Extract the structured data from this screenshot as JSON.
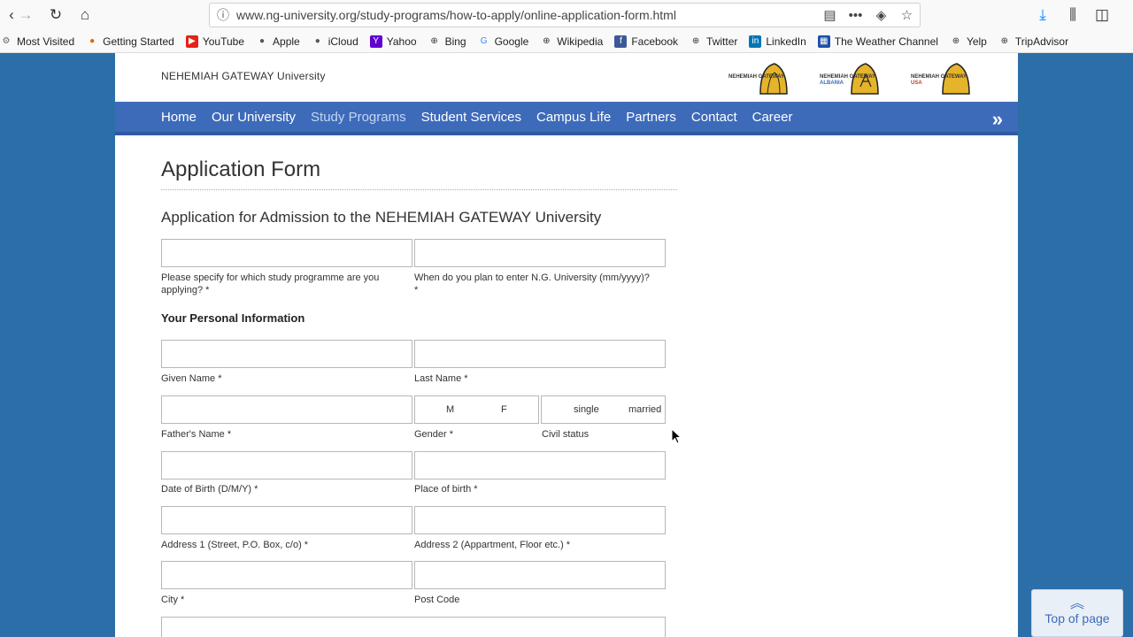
{
  "browser": {
    "url": "www.ng-university.org/study-programs/how-to-apply/online-application-form.html",
    "bookmarks": [
      {
        "label": "Most Visited",
        "icon": "gear-icon"
      },
      {
        "label": "Getting Started",
        "icon": "firefox-icon"
      },
      {
        "label": "YouTube",
        "icon": "youtube-icon"
      },
      {
        "label": "Apple",
        "icon": "apple-icon"
      },
      {
        "label": "iCloud",
        "icon": "apple-icon"
      },
      {
        "label": "Yahoo",
        "icon": "yahoo-icon"
      },
      {
        "label": "Bing",
        "icon": "globe-icon"
      },
      {
        "label": "Google",
        "icon": "google-icon"
      },
      {
        "label": "Wikipedia",
        "icon": "globe-icon"
      },
      {
        "label": "Facebook",
        "icon": "facebook-icon"
      },
      {
        "label": "Twitter",
        "icon": "globe-icon"
      },
      {
        "label": "LinkedIn",
        "icon": "linkedin-icon"
      },
      {
        "label": "The Weather Channel",
        "icon": "weather-icon"
      },
      {
        "label": "Yelp",
        "icon": "globe-icon"
      },
      {
        "label": "TripAdvisor",
        "icon": "globe-icon"
      }
    ]
  },
  "site": {
    "name": "NEHEMIAH GATEWAY University",
    "logos": [
      {
        "text": "NEHEMIAH GATEWAY",
        "sub": ""
      },
      {
        "text": "NEHEMIAH GATEWAY",
        "sub": "ALBANIA"
      },
      {
        "text": "NEHEMIAH GATEWAY",
        "sub": "USA"
      }
    ]
  },
  "nav": {
    "items": [
      "Home",
      "Our University",
      "Study Programs",
      "Student Services",
      "Campus Life",
      "Partners",
      "Contact",
      "Career"
    ],
    "active": "Study Programs"
  },
  "form": {
    "title": "Application Form",
    "subtitle": "Application for Admission to the NEHEMIAH GATEWAY University",
    "section_personal": "Your Personal Information",
    "labels": {
      "programme": "Please specify for which study programme are you applying? *",
      "enter_date": "When do you plan to enter N.G. University (mm/yyyy)? *",
      "given_name": "Given Name *",
      "last_name": "Last Name *",
      "father_name": "Father's Name *",
      "gender": "Gender *",
      "civil_status": "Civil status",
      "dob": "Date of Birth (D/M/Y) *",
      "pob": "Place of birth *",
      "address1": "Address 1 (Street, P.O. Box, c/o) *",
      "address2": "Address 2 (Appartment, Floor etc.) *",
      "city": "City *",
      "post_code": "Post Code"
    },
    "gender_options": [
      "M",
      "F"
    ],
    "civil_options": [
      "single",
      "married"
    ]
  },
  "top_button": "Top of page",
  "colors": {
    "nav_bg": "#3d6bba",
    "body_bg": "#2c6ea8",
    "logo_gold": "#e5b42a"
  }
}
